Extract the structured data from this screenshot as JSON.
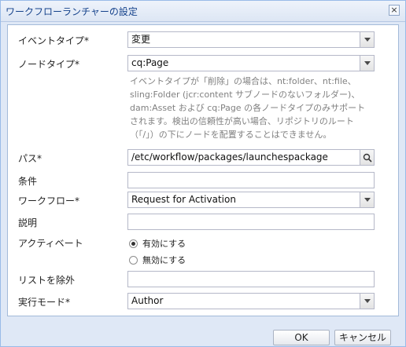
{
  "dialog": {
    "title": "ワークフローランチャーの設定",
    "close_glyph": "×"
  },
  "form": {
    "event_type": {
      "label": "イベントタイプ*",
      "value": "変更"
    },
    "node_type": {
      "label": "ノードタイプ*",
      "value": "cq:Page"
    },
    "help_text": "イベントタイプが「削除」の場合は、nt:folder、nt:file、sling:Folder (jcr:content サブノードのないフォルダー)、dam:Asset および cq:Page の各ノードタイプのみサポートされます。検出の信頼性が高い場合、リポジトリのルート（「/」）の下にノードを配置することはできません。",
    "path": {
      "label": "パス*",
      "value": "/etc/workflow/packages/launchespackage"
    },
    "condition": {
      "label": "条件",
      "value": ""
    },
    "workflow": {
      "label": "ワークフロー*",
      "value": "Request for Activation"
    },
    "description": {
      "label": "説明",
      "value": ""
    },
    "activate": {
      "label": "アクティベート",
      "options": [
        {
          "label": "有効にする",
          "selected": true
        },
        {
          "label": "無効にする",
          "selected": false
        }
      ]
    },
    "exclude_list": {
      "label": "リストを除外",
      "value": ""
    },
    "run_mode": {
      "label": "実行モード*",
      "value": "Author"
    }
  },
  "buttons": {
    "ok": "OK",
    "cancel": "キャンセル"
  },
  "icons": {
    "path_browse": "search-icon",
    "dropdown": "chevron-down-icon"
  }
}
